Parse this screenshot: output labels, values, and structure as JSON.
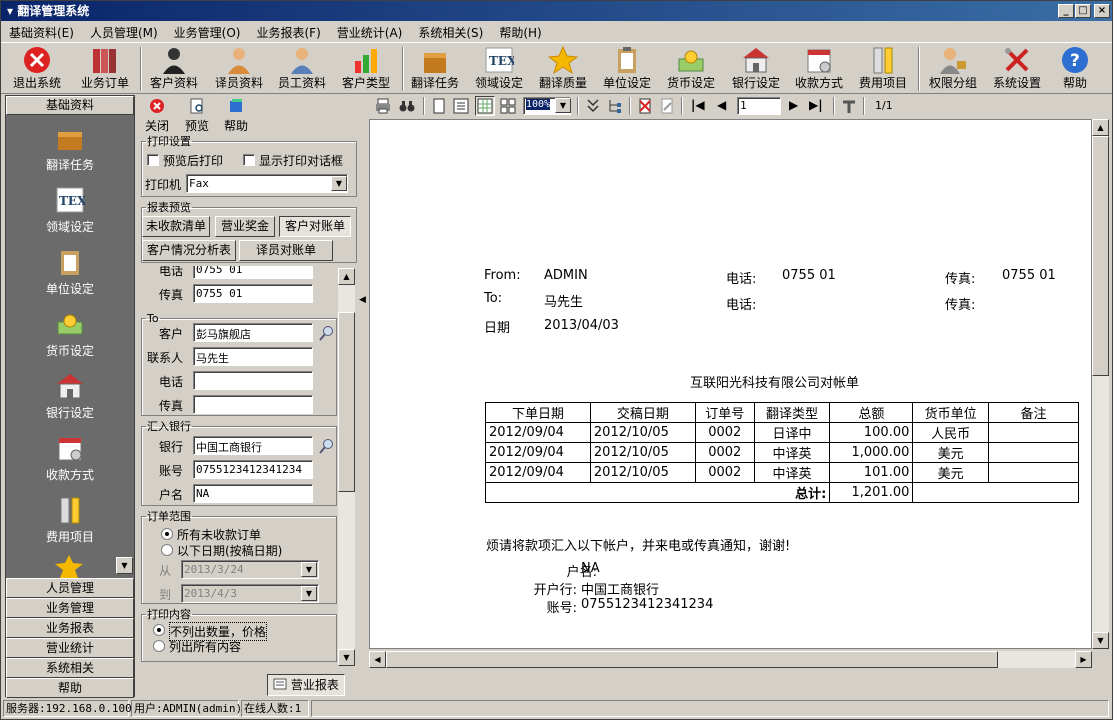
{
  "window": {
    "title": "翻译管理系统"
  },
  "menu": [
    "基础资料(E)",
    "人员管理(M)",
    "业务管理(O)",
    "业务报表(F)",
    "营业统计(A)",
    "系统相关(S)",
    "帮助(H)"
  ],
  "toolbar": [
    "退出系统",
    "业务订单",
    "客户资料",
    "译员资料",
    "员工资料",
    "客户类型",
    "翻译任务",
    "领域设定",
    "翻译质量",
    "单位设定",
    "货币设定",
    "银行设定",
    "收款方式",
    "费用项目",
    "权限分组",
    "系统设置",
    "帮助"
  ],
  "leftnav": {
    "header": "基础资料",
    "items": [
      "翻译任务",
      "领域设定",
      "单位设定",
      "货币设定",
      "银行设定",
      "收款方式",
      "费用项目"
    ],
    "groups": [
      "人员管理",
      "业务管理",
      "业务报表",
      "营业统计",
      "系统相关",
      "帮助"
    ]
  },
  "panel": {
    "close": "关闭",
    "preview": "预览",
    "help": "帮助",
    "print_group": "打印设置",
    "preview_after_print": "预览后打印",
    "show_print_dialog": "显示打印对话框",
    "printer_label": "打印机",
    "printer_value": "Fax",
    "report_group": "报表预览",
    "report_buttons": [
      "未收款清单",
      "营业奖金",
      "客户对账单",
      "客户情况分析表",
      "译员对账单"
    ],
    "from_phone_label": "电话",
    "from_phone_value": "0755 01",
    "from_fax_label": "传真",
    "from_fax_value": "0755 01",
    "to_group": "To",
    "customer_label": "客户",
    "customer_value": "彭马旗舰店",
    "contact_label": "联系人",
    "contact_value": "马先生",
    "to_phone_label": "电话",
    "to_fax_label": "传真",
    "bank_group": "汇入银行",
    "bank_label": "银行",
    "bank_value": "中国工商银行",
    "account_label": "账号",
    "account_value": "0755123412341234",
    "holder_label": "户名",
    "holder_value": "NA",
    "range_group": "订单范围",
    "all_unpaid": "所有未收款订单",
    "by_date": "以下日期(按稿日期)",
    "from_label": "从",
    "from_date": "2013/3/24",
    "to_label": "到",
    "to_date": "2013/4/3",
    "content_group": "打印内容",
    "no_qty": "不列出数量，价格",
    "all_content": "列出所有内容"
  },
  "preview_toolbar": {
    "zoom": "100%",
    "page": "1",
    "pages": "1/1"
  },
  "report": {
    "from_label": "From:",
    "from_value": "ADMIN",
    "to_label": "To:",
    "to_value": "马先生",
    "date_label": "日期",
    "date_value": "2013/04/03",
    "phone_label": "电话:",
    "phone_value": "0755 01",
    "fax_label": "传真:",
    "fax_value": "0755 01",
    "to_phone_label": "电话:",
    "to_fax_label": "传真:",
    "title": "互联阳光科技有限公司对帐单",
    "columns": [
      "下单日期",
      "交稿日期",
      "订单号",
      "翻译类型",
      "总额",
      "货币单位",
      "备注"
    ],
    "rows": [
      [
        "2012/09/04",
        "2012/10/05",
        "0002",
        "日译中",
        "100.00",
        "人民币",
        ""
      ],
      [
        "2012/09/04",
        "2012/10/05",
        "0002",
        "中译英",
        "1,000.00",
        "美元",
        ""
      ],
      [
        "2012/09/04",
        "2012/10/05",
        "0002",
        "中译英",
        "101.00",
        "美元",
        ""
      ]
    ],
    "total_label": "总计:",
    "total_value": "1,201.00",
    "note": "烦请将款项汇入以下帐户，并来电或传真通知，谢谢!",
    "holder_label": "户名:",
    "holder_value": "NA",
    "bank_label": "开户行:",
    "bank_value": "中国工商银行",
    "account_label": "账号:",
    "account_value": "0755123412341234"
  },
  "tasktab": "营业报表",
  "status": {
    "server": "服务器:192.168.0.100",
    "user": "用户:ADMIN(admin)",
    "online": "在线人数:1"
  }
}
